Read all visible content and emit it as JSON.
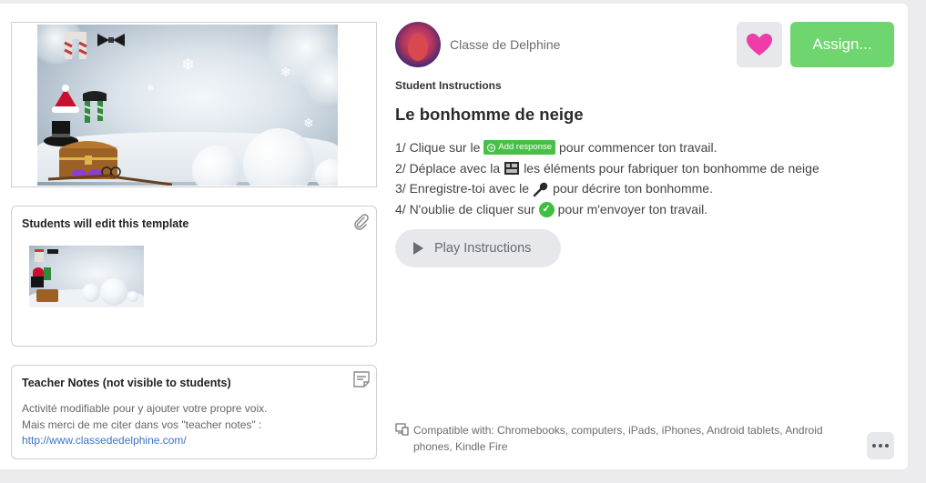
{
  "author": {
    "name": "Classe de Delphine"
  },
  "actions": {
    "assign_label": "Assign..."
  },
  "instructions": {
    "section_label": "Student Instructions",
    "title": "Le bonhomme de neige",
    "add_response_chip": "Add response",
    "steps": [
      {
        "before": "1/ Clique sur le",
        "after": "pour commencer ton travail.",
        "icon": "add-response-chip"
      },
      {
        "before": "2/ Déplace avec la",
        "after": "les éléments pour fabriquer ton bonhomme de neige",
        "icon": "move-tool-icon"
      },
      {
        "before": "3/ Enregistre-toi avec le",
        "after": "pour décrire ton bonhomme.",
        "icon": "microphone-icon"
      },
      {
        "before": "4/ N'oublie de cliquer sur",
        "after": "pour m'envoyer ton travail.",
        "icon": "check-circle-icon"
      }
    ],
    "play_label": "Play Instructions"
  },
  "template": {
    "title": "Students will edit this template"
  },
  "notes": {
    "title": "Teacher Notes (not visible to students)",
    "line1": "Activité modifiable pour y ajouter votre propre voix.",
    "line2": "Mais merci de me citer dans vos \"teacher notes\"  :",
    "link": "http://www.classededelphine.com/"
  },
  "compatibility": {
    "text": "Compatible with: Chromebooks, computers, iPads, iPhones, Android tablets, Android phones, Kindle Fire"
  },
  "colors": {
    "assign": "#6fd66f",
    "heart": "#f03ca6",
    "link": "#3a73c6",
    "add_chip": "#48c048"
  }
}
